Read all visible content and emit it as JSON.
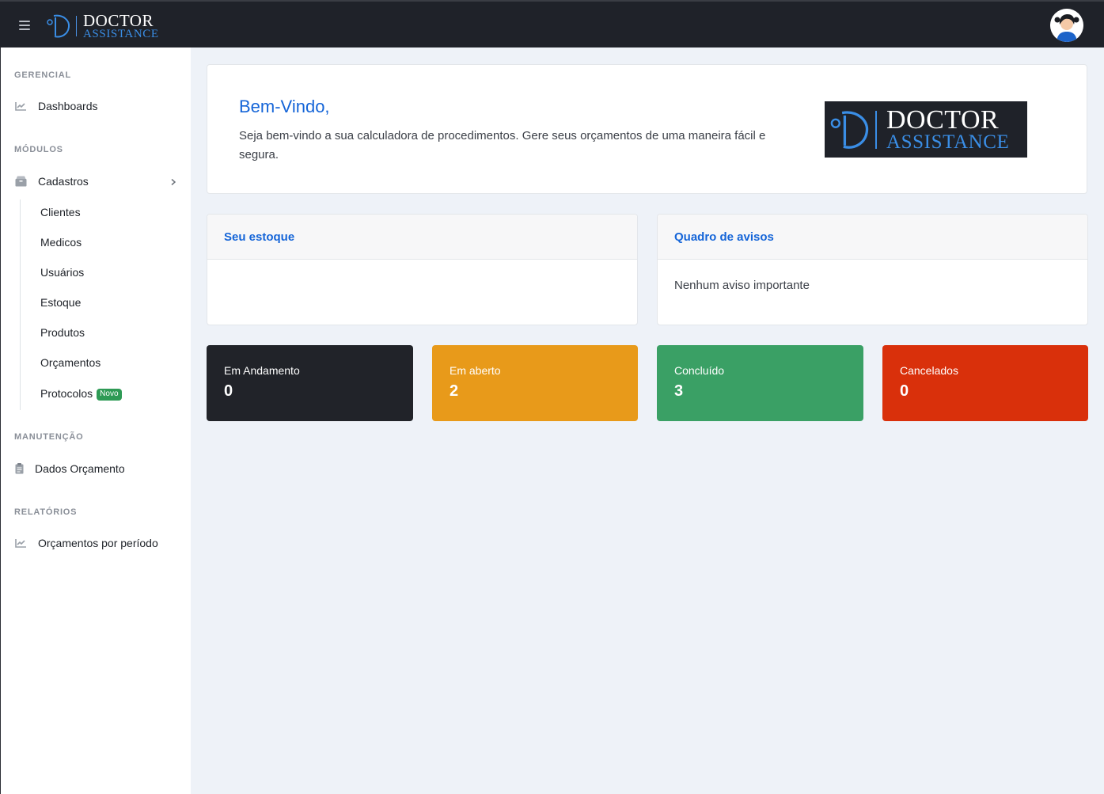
{
  "app": {
    "brand_line1": "DOCTOR",
    "brand_line2": "ASSISTANCE"
  },
  "icons": {
    "menu": "hamburger-icon",
    "user": "avatar-icon"
  },
  "sidebar": {
    "sections": {
      "gerencial": "GERENCIAL",
      "modulos": "MÓDULOS",
      "manutencao": "MANUTENÇÃO",
      "relatorios": "RELATÓRIOS"
    },
    "dashboards": "Dashboards",
    "cadastros": "Cadastros",
    "sub_items": [
      "Clientes",
      "Medicos",
      "Usuários",
      "Estoque",
      "Produtos",
      "Orçamentos",
      "Protocolos"
    ],
    "new_badge": "Novo",
    "dados_orcamento": "Dados Orçamento",
    "orcamentos_periodo": "Orçamentos por período"
  },
  "welcome": {
    "title": "Bem-Vindo,",
    "text": "Seja bem-vindo a sua calculadora de procedimentos. Gere seus orçamentos de uma maneira fácil e segura."
  },
  "estoque": {
    "title": "Seu estoque"
  },
  "avisos": {
    "title": "Quadro de avisos",
    "message": "Nenhum aviso importante"
  },
  "stats": [
    {
      "label": "Em Andamento",
      "value": "0",
      "color": "#212329"
    },
    {
      "label": "Em aberto",
      "value": "2",
      "color": "#e89a1a"
    },
    {
      "label": "Concluído",
      "value": "3",
      "color": "#3aa065"
    },
    {
      "label": "Cancelados",
      "value": "0",
      "color": "#d9300b"
    }
  ]
}
